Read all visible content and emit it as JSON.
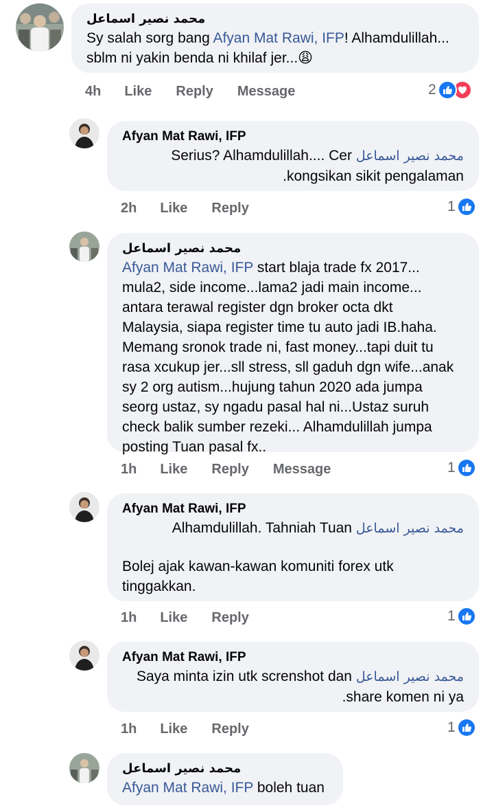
{
  "comments": [
    {
      "author": "محمد نصير اسماعل",
      "text_parts": [
        "Sy salah sorg bang ",
        "Afyan Mat Rawi, IFP",
        "! Alhamdulillah...",
        "sblm ni yakin benda ni khilaf jer...😩"
      ],
      "time": "4h",
      "actions": [
        "Like",
        "Reply",
        "Message"
      ],
      "reaction_count": "2",
      "reactions": [
        "like-icon",
        "love-icon"
      ]
    },
    {
      "author": "Afyan Mat Rawi, IFP",
      "mention": "محمد نصير اسماعل",
      "text_line1_after": "Serius? Alhamdulillah.... Cer",
      "text_line2": "kongsikan sikit pengalaman.",
      "time": "2h",
      "actions": [
        "Like",
        "Reply"
      ],
      "reaction_count": "1",
      "reactions": [
        "like-icon"
      ]
    },
    {
      "author": "محمد نصير اسماعل",
      "mention": "Afyan Mat Rawi, IFP",
      "lines": [
        " start blaja trade fx 2017...",
        "mula2, side income...lama2 jadi main income...",
        "antara terawal register dgn broker octa dkt",
        "Malaysia, siapa register time tu auto jadi IB.haha.",
        "Memang sronok trade ni, fast money...tapi duit tu",
        "rasa xcukup jer...sll stress, sll gaduh dgn wife...anak",
        "sy 2 org autism...hujung tahun 2020 ada jumpa",
        "seorg ustaz, sy ngadu pasal hal ni...Ustaz suruh",
        "check balik sumber rezeki... Alhamdulillah jumpa",
        "posting Tuan pasal fx.."
      ],
      "time": "1h",
      "actions": [
        "Like",
        "Reply",
        "Message"
      ],
      "reaction_count": "1",
      "reactions": [
        "like-icon"
      ]
    },
    {
      "author": "Afyan Mat Rawi, IFP",
      "mention": "محمد نصير اسماعل",
      "text_line1_after": "Alhamdulillah. Tahniah Tuan",
      "para2_line1": "Bolej ajak kawan-kawan komuniti forex utk",
      "para2_line2": "tinggakkan.",
      "time": "1h",
      "actions": [
        "Like",
        "Reply"
      ],
      "reaction_count": "1",
      "reactions": [
        "like-icon"
      ]
    },
    {
      "author": "Afyan Mat Rawi, IFP",
      "mention": "محمد نصير اسماعل",
      "text_line1_after": "Saya minta izin utk screnshot dan",
      "text_line2": "share komen ni ya.",
      "time": "1h",
      "actions": [
        "Like",
        "Reply"
      ],
      "reaction_count": "1",
      "reactions": [
        "like-icon"
      ]
    },
    {
      "author": "محمد نصير اسماعل",
      "mention": "Afyan Mat Rawi, IFP",
      "text_after": " boleh tuan"
    }
  ],
  "colors": {
    "bubble_bg": "#f0f2f5",
    "mention": "#385898",
    "meta": "#65676b",
    "like_blue": "#1877f2",
    "love_red": "#f33e58"
  }
}
